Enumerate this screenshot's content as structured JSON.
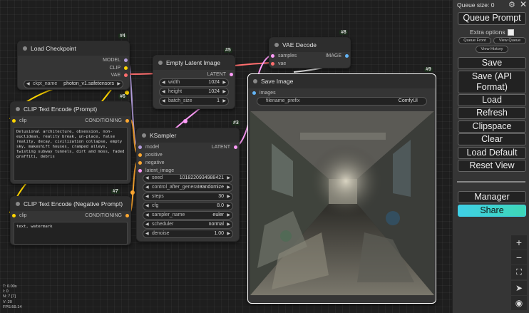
{
  "canvas": {
    "nodes": {
      "load_checkpoint": {
        "id": "#4",
        "title": "Load Checkpoint",
        "outputs": [
          "MODEL",
          "CLIP",
          "VAE"
        ],
        "ckpt_label": "ckpt_name",
        "ckpt_value": "photon_v1.safetensors"
      },
      "clip_positive": {
        "id": "#6",
        "title": "CLIP Text Encode (Prompt)",
        "input": "clip",
        "output": "CONDITIONING",
        "text": "Delusional architecture, obsession, non-euclidean, reality break, un-place, false reality, decay, civilization collapse, empty sky, makeshift houses, cramped alleys, twisting subway tunnels, dirt and moss, faded graffiti, debris"
      },
      "clip_negative": {
        "id": "#7",
        "title": "CLIP Text Encode (Negative Prompt)",
        "input": "clip",
        "output": "CONDITIONING",
        "text": "text, watermark"
      },
      "empty_latent": {
        "id": "#5",
        "title": "Empty Latent Image",
        "output": "LATENT",
        "widgets": [
          {
            "label": "width",
            "value": "1024"
          },
          {
            "label": "height",
            "value": "1024"
          },
          {
            "label": "batch_size",
            "value": "1"
          }
        ]
      },
      "ksampler": {
        "id": "#3",
        "title": "KSampler",
        "output": "LATENT",
        "inputs": [
          "model",
          "positive",
          "negative",
          "latent_image"
        ],
        "widgets": [
          {
            "label": "seed",
            "value": "1018220934988421"
          },
          {
            "label": "control_after_generate",
            "value": "randomize"
          },
          {
            "label": "steps",
            "value": "30"
          },
          {
            "label": "cfg",
            "value": "8.0"
          },
          {
            "label": "sampler_name",
            "value": "euler"
          },
          {
            "label": "scheduler",
            "value": "normal"
          },
          {
            "label": "denoise",
            "value": "1.00"
          }
        ]
      },
      "vae_decode": {
        "id": "#8",
        "title": "VAE Decode",
        "inputs": [
          "samples",
          "vae"
        ],
        "output": "IMAGE"
      },
      "save_image": {
        "id": "#9",
        "title": "Save Image",
        "input": "images",
        "prefix_label": "filename_prefix",
        "prefix_value": "ComfyUI"
      }
    },
    "stats": [
      "T: 0.00s",
      "I: 0",
      "N: 7 [7]",
      "V: 20",
      "FPS:59.14"
    ]
  },
  "menu": {
    "queue_size": "Queue size: 0",
    "queue_prompt": "Queue Prompt",
    "extra_options": "Extra options",
    "queue_front": "Queue Front",
    "view_queue": "View Queue",
    "view_history": "View History",
    "buttons": [
      "Save",
      "Save (API Format)",
      "Load",
      "Refresh",
      "Clipspace",
      "Clear",
      "Load Default",
      "Reset View"
    ],
    "manager": "Manager",
    "share": "Share",
    "share_color": "#3fd0e6"
  },
  "colors": {
    "model": "#b39ddb",
    "clip": "#ffd500",
    "vae": "#ff6e6e",
    "conditioning": "#ffa931",
    "latent": "#ff9cf9",
    "image": "#64b5f6"
  },
  "canvas_tools": [
    "zoom-in-icon",
    "zoom-out-icon",
    "fit-view-icon",
    "arrange-icon",
    "toggle-visibility-icon"
  ]
}
